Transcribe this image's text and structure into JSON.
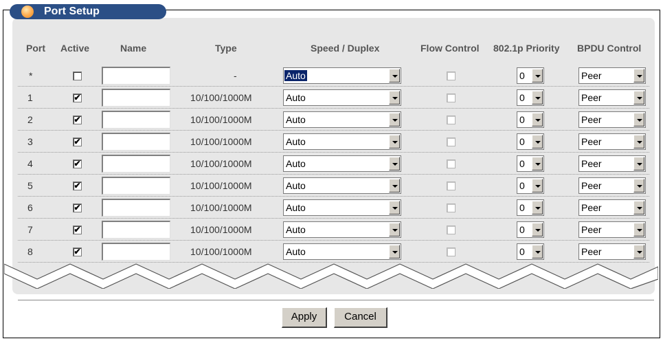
{
  "panel": {
    "title": "Port Setup"
  },
  "columns": {
    "port": "Port",
    "active": "Active",
    "name": "Name",
    "type": "Type",
    "speed_duplex": "Speed / Duplex",
    "flow_control": "Flow Control",
    "priority": "802.1p Priority",
    "bpdu": "BPDU Control"
  },
  "rows": [
    {
      "port": "*",
      "active": false,
      "name": "",
      "type": "-",
      "speed": "Auto",
      "flow": false,
      "priority": "0",
      "bpdu": "Peer"
    },
    {
      "port": "1",
      "active": true,
      "name": "",
      "type": "10/100/1000M",
      "speed": "Auto",
      "flow": false,
      "priority": "0",
      "bpdu": "Peer"
    },
    {
      "port": "2",
      "active": true,
      "name": "",
      "type": "10/100/1000M",
      "speed": "Auto",
      "flow": false,
      "priority": "0",
      "bpdu": "Peer"
    },
    {
      "port": "3",
      "active": true,
      "name": "",
      "type": "10/100/1000M",
      "speed": "Auto",
      "flow": false,
      "priority": "0",
      "bpdu": "Peer"
    },
    {
      "port": "4",
      "active": true,
      "name": "",
      "type": "10/100/1000M",
      "speed": "Auto",
      "flow": false,
      "priority": "0",
      "bpdu": "Peer"
    },
    {
      "port": "5",
      "active": true,
      "name": "",
      "type": "10/100/1000M",
      "speed": "Auto",
      "flow": false,
      "priority": "0",
      "bpdu": "Peer"
    },
    {
      "port": "6",
      "active": true,
      "name": "",
      "type": "10/100/1000M",
      "speed": "Auto",
      "flow": false,
      "priority": "0",
      "bpdu": "Peer"
    },
    {
      "port": "7",
      "active": true,
      "name": "",
      "type": "10/100/1000M",
      "speed": "Auto",
      "flow": false,
      "priority": "0",
      "bpdu": "Peer"
    },
    {
      "port": "8",
      "active": true,
      "name": "",
      "type": "10/100/1000M",
      "speed": "Auto",
      "flow": false,
      "priority": "0",
      "bpdu": "Peer"
    }
  ],
  "buttons": {
    "apply": "Apply",
    "cancel": "Cancel"
  },
  "icons": {
    "title_orb": "orb-icon",
    "dropdown": "chevron-down-icon",
    "check": "check-icon"
  },
  "colors": {
    "title_bar": "#2b4f86",
    "panel_bg": "#e7e7e7",
    "selected_bg": "#0a246a"
  }
}
